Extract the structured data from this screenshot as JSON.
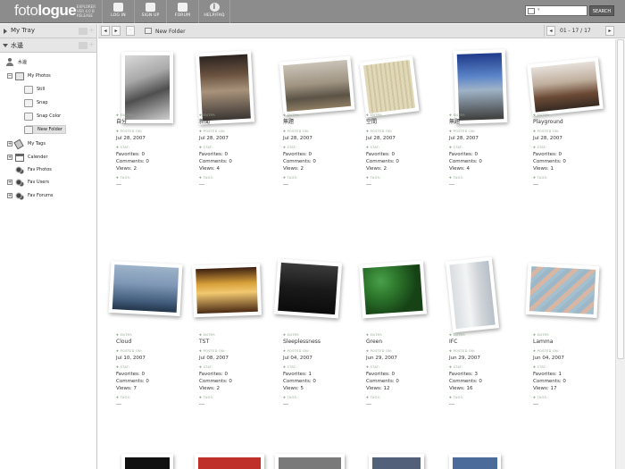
{
  "header": {
    "logo_light": "foto",
    "logo_bold": "logue",
    "logo_sub": [
      "EXPLORER",
      "VER 4.0 B",
      "RELEASE"
    ],
    "nav": [
      {
        "label": "LOG IN",
        "icon": "login-icon"
      },
      {
        "label": "SIGN UP",
        "icon": "signup-icon"
      },
      {
        "label": "FORUM",
        "icon": "forum-icon"
      },
      {
        "label": "HELP/FAQ",
        "icon": "info-icon"
      }
    ],
    "search_button": "SEARCH"
  },
  "sidebar": {
    "my_tray": "My Tray",
    "user_section": "水邊",
    "tree": {
      "user": "水邊",
      "my_photos": "My Photos",
      "folders": [
        "Still",
        "Snap",
        "Snap Color",
        "New Folder"
      ],
      "my_tags": "My Tags",
      "calendar": "Calender",
      "fav_photos": "Fav Photos",
      "fav_users": "Fav Users",
      "fav_forums": "Fav Forums"
    }
  },
  "toolbar": {
    "prev": "◂",
    "next": "▸",
    "folder_name": "New Folder",
    "page_range": "01 - 17 / 17"
  },
  "labels": {
    "entry": "ENTRY:",
    "posted_on": "POSTED ON:",
    "stat": "STAT:",
    "favorites": "Favorites:",
    "comments": "Comments:",
    "views": "Views:",
    "tags": "TAGS:"
  },
  "photos": [
    {
      "title": "自分",
      "date": "Jul 28, 2007",
      "favorites": "0",
      "comments": "0",
      "views": "2",
      "tags": "---"
    },
    {
      "title": "新聞",
      "date": "Jul 28, 2007",
      "favorites": "0",
      "comments": "0",
      "views": "4",
      "tags": "---"
    },
    {
      "title": "無題",
      "date": "Jul 28, 2007",
      "favorites": "0",
      "comments": "0",
      "views": "2",
      "tags": "---"
    },
    {
      "title": "空間",
      "date": "Jul 28, 2007",
      "favorites": "0",
      "comments": "0",
      "views": "2",
      "tags": "---"
    },
    {
      "title": "無題",
      "date": "Jul 28, 2007",
      "favorites": "0",
      "comments": "0",
      "views": "4",
      "tags": "---"
    },
    {
      "title": "Playground",
      "date": "Jul 28, 2007",
      "favorites": "0",
      "comments": "0",
      "views": "1",
      "tags": "---"
    },
    {
      "title": "Cloud",
      "date": "Jul 10, 2007",
      "favorites": "0",
      "comments": "0",
      "views": "7",
      "tags": "---"
    },
    {
      "title": "TST",
      "date": "Jul 08, 2007",
      "favorites": "0",
      "comments": "0",
      "views": "2",
      "tags": "---"
    },
    {
      "title": "Sleeplessness",
      "date": "Jul 04, 2007",
      "favorites": "1",
      "comments": "0",
      "views": "5",
      "tags": "---"
    },
    {
      "title": "Green",
      "date": "Jun 29, 2007",
      "favorites": "0",
      "comments": "0",
      "views": "12",
      "tags": "---"
    },
    {
      "title": "IFC",
      "date": "Jun 29, 2007",
      "favorites": "3",
      "comments": "0",
      "views": "16",
      "tags": "---"
    },
    {
      "title": "Lamma",
      "date": "Jun 04, 2007",
      "favorites": "1",
      "comments": "0",
      "views": "17",
      "tags": "---"
    }
  ]
}
